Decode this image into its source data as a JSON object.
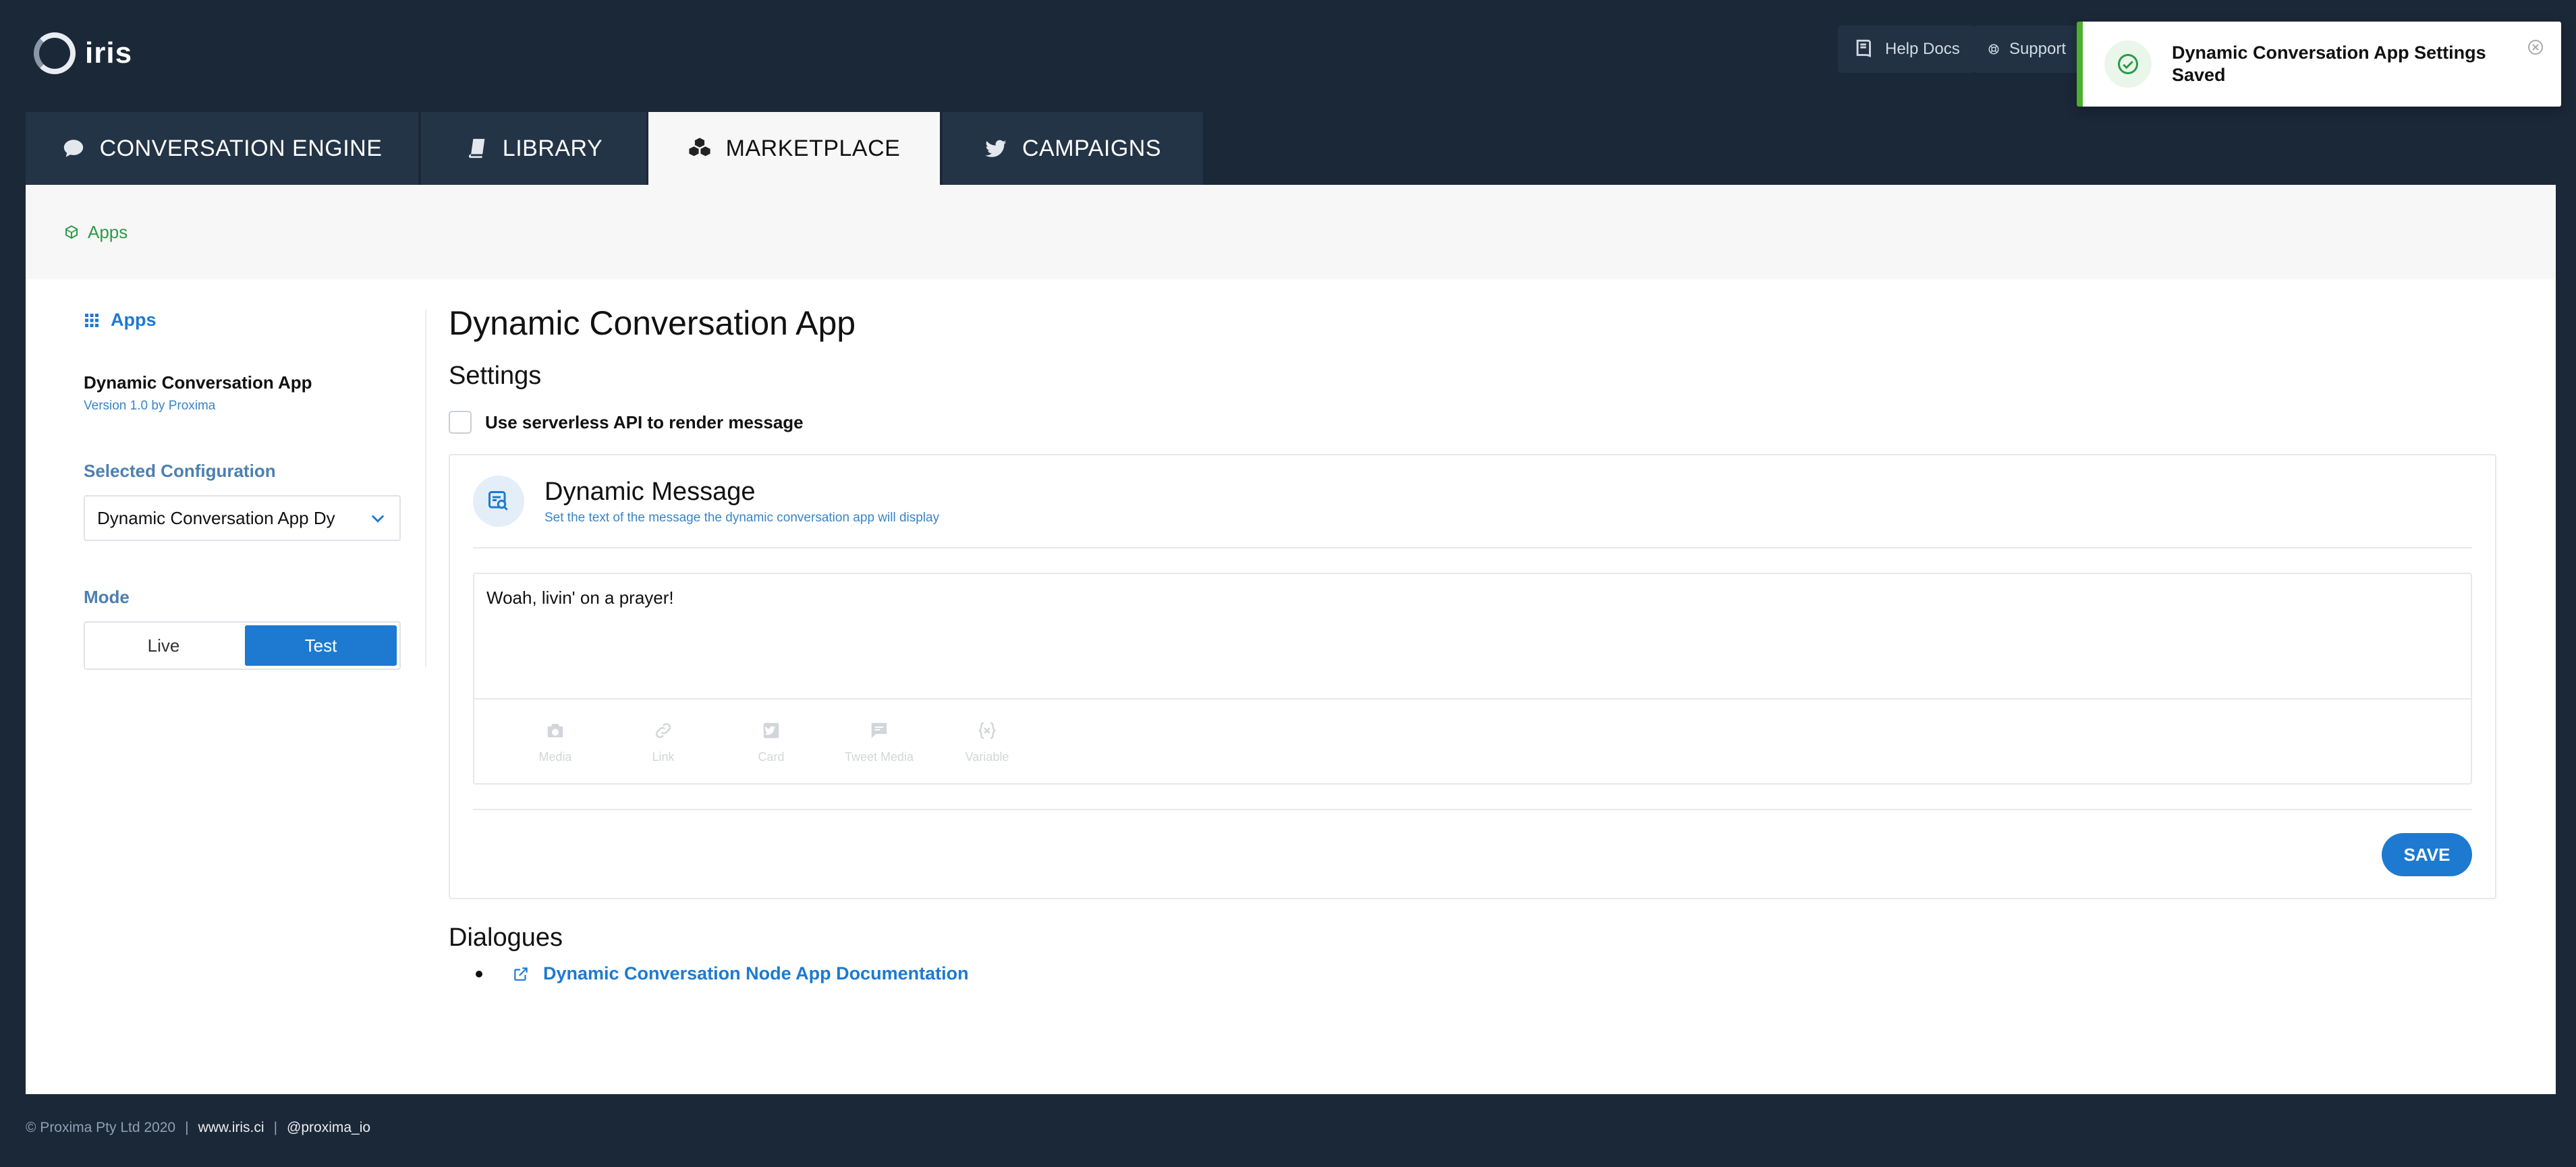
{
  "app": {
    "brand": "iris"
  },
  "topbar": {
    "help_docs": "Help Docs",
    "support": "Support"
  },
  "tabs": [
    {
      "label": "CONVERSATION ENGINE",
      "icon": "comment-icon",
      "active": false
    },
    {
      "label": "LIBRARY",
      "icon": "book-icon",
      "active": false
    },
    {
      "label": "MARKETPLACE",
      "icon": "cubes-icon",
      "active": true
    },
    {
      "label": "CAMPAIGNS",
      "icon": "twitter-icon",
      "active": false
    }
  ],
  "breadcrumb": {
    "label": "Apps"
  },
  "sidebar": {
    "apps_link": "Apps",
    "app_name": "Dynamic Conversation App",
    "app_version": "Version 1.0 by Proxima",
    "selected_config_label": "Selected Configuration",
    "selected_config_value": "Dynamic Conversation App Dy",
    "mode_label": "Mode",
    "mode_options": [
      "Live",
      "Test"
    ],
    "mode_selected": "Test"
  },
  "main": {
    "title": "Dynamic Conversation App",
    "settings_heading": "Settings",
    "serverless_checkbox_label": "Use serverless API to render message",
    "serverless_checked": false,
    "card": {
      "title": "Dynamic Message",
      "subtitle": "Set the text of the message the dynamic conversation app will display",
      "message": "Woah, livin' on a prayer!",
      "toolbar": [
        "Media",
        "Link",
        "Card",
        "Tweet Media",
        "Variable"
      ],
      "save_label": "SAVE"
    },
    "dialogues_heading": "Dialogues",
    "doc_link": "Dynamic Conversation Node App Documentation"
  },
  "footer": {
    "copyright": "© Proxima Pty Ltd 2020",
    "sep": "|",
    "site": "www.iris.ci",
    "handle": "@proxima_io"
  },
  "toast": {
    "message": "Dynamic Conversation App Settings Saved",
    "status": "success",
    "accent": "#4caf2d"
  },
  "colors": {
    "background": "#1b2838",
    "primary": "#1d7ad0",
    "success": "#2b9b47"
  }
}
